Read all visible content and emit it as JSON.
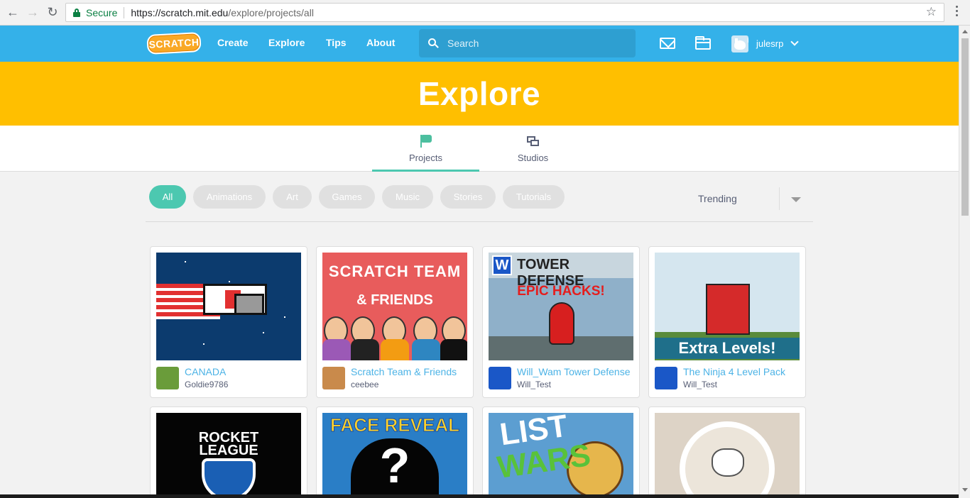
{
  "browser": {
    "secure_label": "Secure",
    "url_host": "https://scratch.mit.edu",
    "url_path": "/explore/projects/all"
  },
  "navbar": {
    "logo_text": "SCRATCH",
    "links": [
      "Create",
      "Explore",
      "Tips",
      "About"
    ],
    "search_placeholder": "Search",
    "username": "julesrp",
    "brand_color": "#34b1e9"
  },
  "banner": {
    "title": "Explore",
    "color": "#ffbf00"
  },
  "tabs": [
    {
      "label": "Projects",
      "icon": "flag-icon",
      "active": true
    },
    {
      "label": "Studios",
      "icon": "studio-icon",
      "active": false
    }
  ],
  "filters": [
    "All",
    "Animations",
    "Art",
    "Games",
    "Music",
    "Stories",
    "Tutorials"
  ],
  "active_filter": "All",
  "sort": {
    "selected": "Trending"
  },
  "projects": [
    {
      "title": "CANADA",
      "owner": "Goldie9786"
    },
    {
      "title": "Scratch Team & Friends",
      "owner": "ceebee",
      "thumb_text": [
        "SCRATCH TEAM",
        "& FRIENDS"
      ]
    },
    {
      "title": "Will_Wam Tower Defense",
      "owner": "Will_Test",
      "thumb_text": [
        "W",
        "TOWER DEFENSE",
        "EPIC HACKS!"
      ]
    },
    {
      "title": "The Ninja 4 Level Pack",
      "owner": "Will_Test",
      "thumb_text": [
        "Extra Levels!"
      ]
    },
    {
      "thumb_text": [
        "ROCKET",
        "LEAGUE"
      ]
    },
    {
      "thumb_text": [
        "FACE REVEAL",
        "?"
      ]
    },
    {
      "thumb_text": [
        "LIST",
        "WARS"
      ]
    },
    {
      "thumb_text": []
    }
  ]
}
